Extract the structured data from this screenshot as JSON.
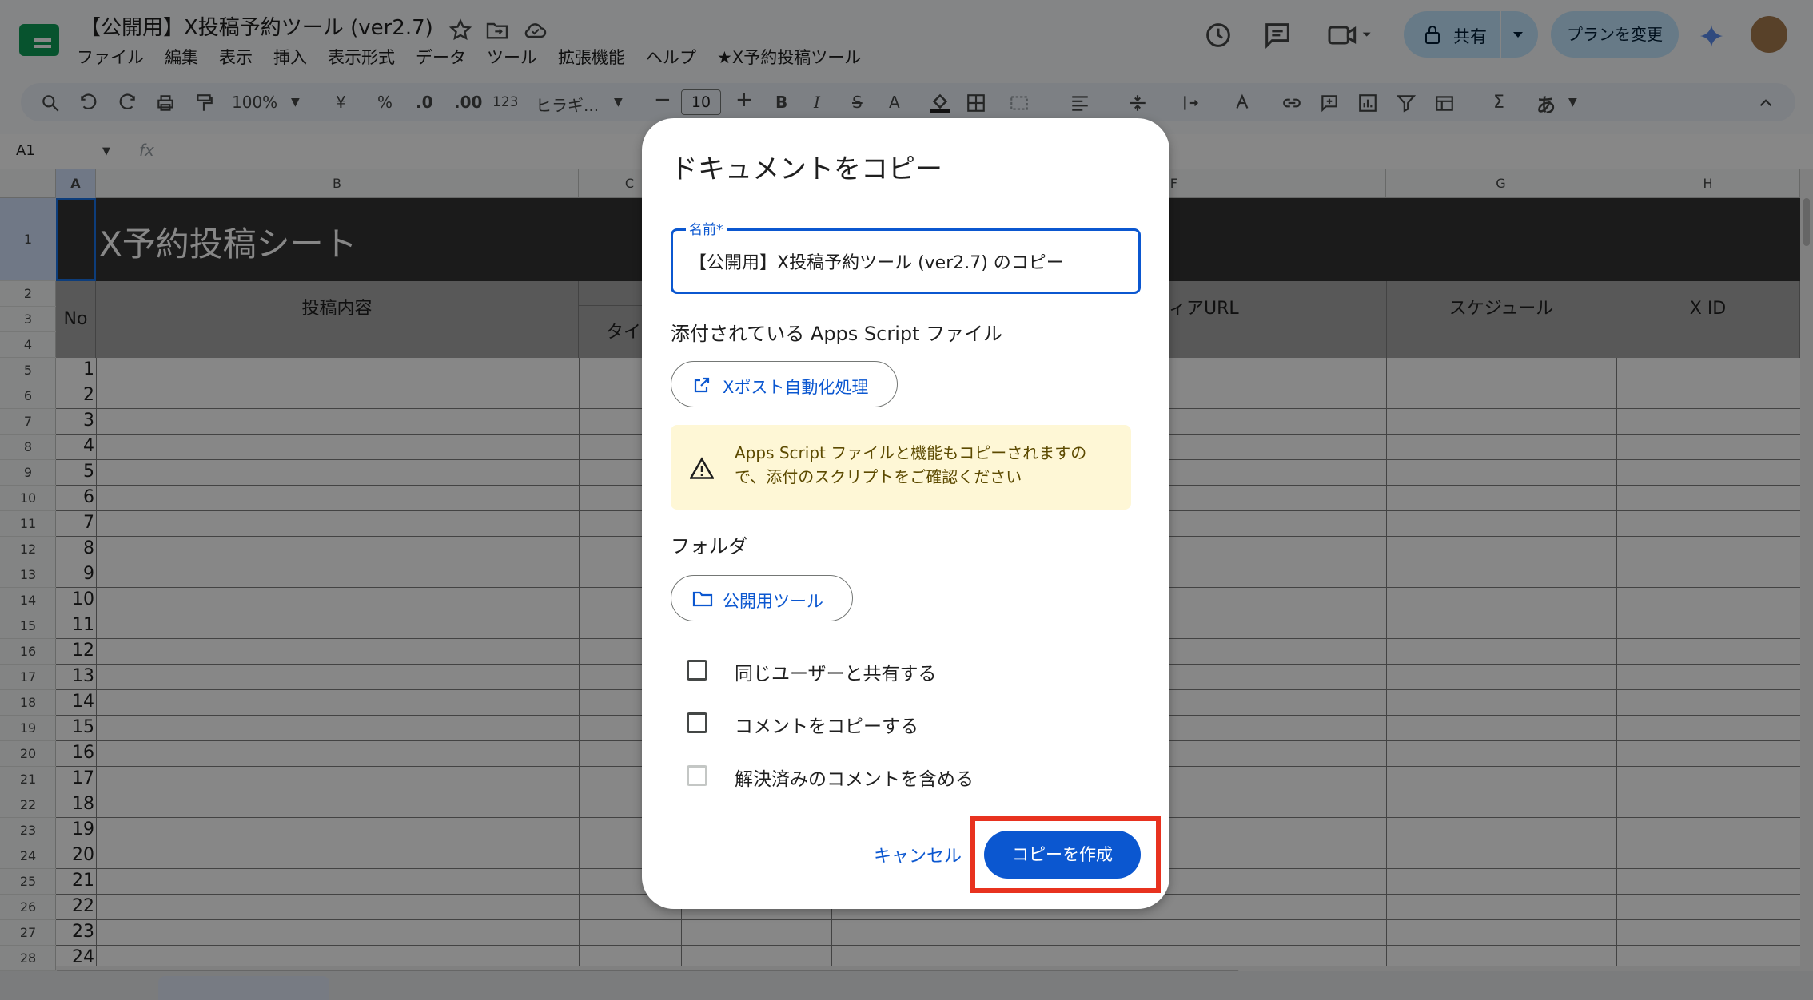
{
  "header": {
    "doc_title": "【公開用】X投稿予約ツール (ver2.7)",
    "menu": [
      "ファイル",
      "編集",
      "表示",
      "挿入",
      "表示形式",
      "データ",
      "ツール",
      "拡張機能",
      "ヘルプ",
      "★X予約投稿ツール"
    ],
    "share_label": "共有",
    "plan_label": "プランを変更"
  },
  "toolbar": {
    "zoom": "100%",
    "currency": "¥",
    "percent": "%",
    "dec_less": ".0",
    "dec_more": ".00",
    "number_format": "123",
    "font": "ヒラギ...",
    "font_size": "10",
    "bold": "B",
    "italic": "I",
    "strike": "S",
    "text_color": "A",
    "input_mode": "あ"
  },
  "formula": {
    "name_box": "A1",
    "fx": "fx"
  },
  "sheet": {
    "columns": [
      "A",
      "B",
      "C",
      "F",
      "G",
      "H"
    ],
    "title": "X予約投稿シート",
    "headers": {
      "no": "No",
      "content": "投稿内容",
      "type_partial": "タイ",
      "media_partial": "ィアURL",
      "schedule": "スケジュール",
      "xid": "X ID"
    },
    "row_numbers": [
      1,
      2,
      3,
      4,
      5,
      6,
      7,
      8,
      9,
      10,
      11,
      12,
      13,
      14,
      15,
      16,
      17,
      18,
      19,
      20,
      21,
      22,
      23,
      24,
      25,
      26,
      27,
      28
    ],
    "item_numbers": [
      1,
      2,
      3,
      4,
      5,
      6,
      7,
      8,
      9,
      10,
      11,
      12,
      13,
      14,
      15,
      16,
      17,
      18,
      19,
      20,
      21,
      22,
      23,
      24
    ]
  },
  "dialog": {
    "title": "ドキュメントをコピー",
    "name_label": "名前*",
    "name_value": "【公開用】X投稿予約ツール (ver2.7) のコピー",
    "apps_script_heading": "添付されている Apps Script ファイル",
    "script_chip": "Xポスト自動化処理",
    "warning": "Apps Script ファイルと機能もコピーされますので、添付のスクリプトをご確認ください",
    "folder_heading": "フォルダ",
    "folder_chip": "公開用ツール",
    "checkbox_share": "同じユーザーと共有する",
    "checkbox_comments": "コメントをコピーする",
    "checkbox_resolved": "解決済みのコメントを含める",
    "cancel": "キャンセル",
    "create": "コピーを作成"
  },
  "colors": {
    "accent": "#0b57d0",
    "highlight": "#e8321f",
    "warning_bg": "#fef7d6"
  }
}
